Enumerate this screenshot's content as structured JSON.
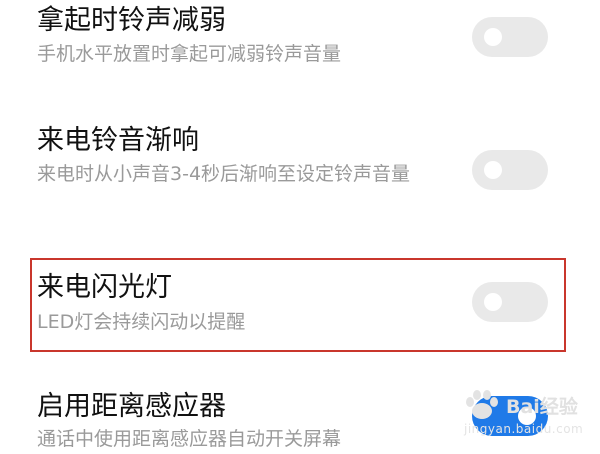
{
  "settings": [
    {
      "title": "拿起时铃声减弱",
      "description": "手机水平放置时拿起可减弱铃声音量",
      "enabled": false
    },
    {
      "title": "来电铃音渐响",
      "description": "来电时从小声音3-4秒后渐响至设定铃声音量",
      "enabled": false
    },
    {
      "title": "来电闪光灯",
      "description": "LED灯会持续闪动以提醒",
      "enabled": false
    },
    {
      "title": "启用距离感应器",
      "description": "通话中使用距离感应器自动开关屏幕",
      "enabled": true
    }
  ],
  "watermark": {
    "brand": "Bai",
    "suffix": "经验",
    "url": "jingyan.baidu.com"
  },
  "colors": {
    "toggle_off": "#e9e9e9",
    "toggle_on": "#1f7ae8",
    "highlight_border": "#c9362c",
    "title_text": "#111111",
    "description_text": "#9a9a9a"
  }
}
